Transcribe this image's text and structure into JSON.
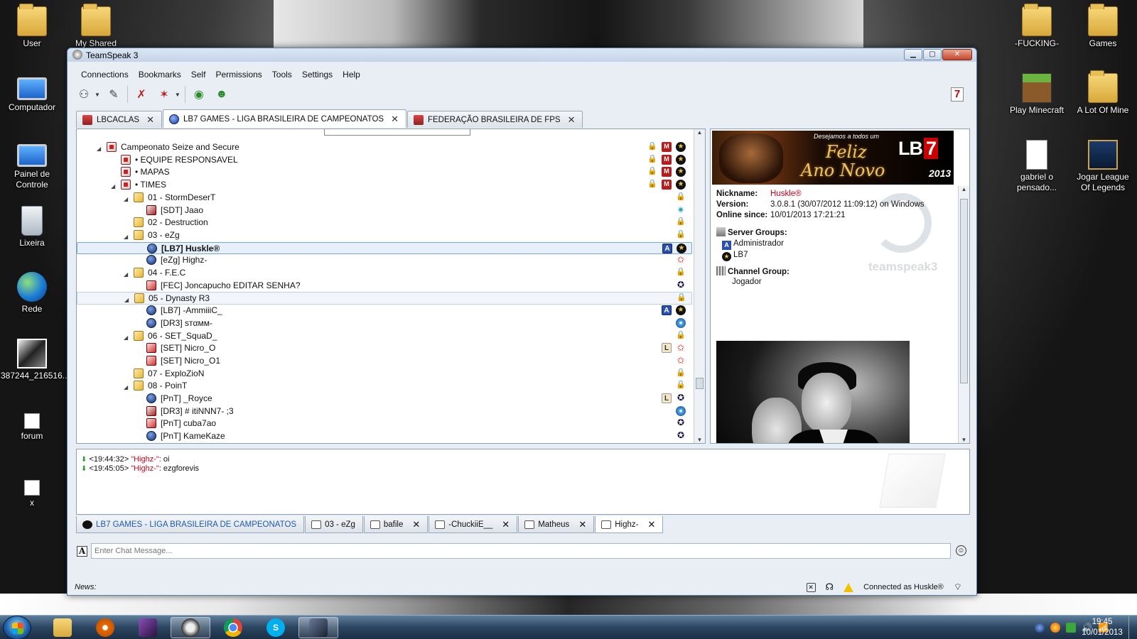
{
  "desktop": {
    "icons_left": [
      {
        "label": "User",
        "type": "folder"
      },
      {
        "label": "My Shared",
        "type": "folder"
      },
      {
        "label": "Computador",
        "type": "monitor"
      },
      {
        "label": "Painel de Controle",
        "type": "monitor"
      },
      {
        "label": "Lixeira",
        "type": "recycle"
      },
      {
        "label": "Rede",
        "type": "globe"
      },
      {
        "label": "387244_216516...",
        "type": "photo"
      },
      {
        "label": "forum",
        "type": "file"
      },
      {
        "label": "x",
        "type": "file"
      }
    ],
    "icons_right": [
      {
        "label": "-FUCKING-",
        "type": "folder"
      },
      {
        "label": "Games",
        "type": "folder"
      },
      {
        "label": "Play Minecraft",
        "type": "minecraft"
      },
      {
        "label": "A Lot Of Mine",
        "type": "folder"
      },
      {
        "label": "gabriel o pensado...",
        "type": "mp3"
      },
      {
        "label": "Jogar League Of Legends",
        "type": "lol"
      }
    ]
  },
  "window": {
    "title": "TeamSpeak 3",
    "controls": [
      "minimize",
      "maximize",
      "close"
    ]
  },
  "menu": [
    "Connections",
    "Bookmarks",
    "Self",
    "Permissions",
    "Tools",
    "Settings",
    "Help"
  ],
  "server_tabs": [
    {
      "label": "LBCACLAS",
      "icon": "speaker",
      "active": false
    },
    {
      "label": "LB7 GAMES - LIGA BRASILEIRA DE CAMPEONATOS",
      "icon": "dot",
      "active": true
    },
    {
      "label": "FEDERAÇÃO BRASILEIRA DE FPS",
      "icon": "speaker",
      "active": false
    }
  ],
  "tree": [
    {
      "label": "Campeonato Seize and Secure",
      "depth": 0,
      "kind": "channel",
      "arrow": true,
      "badges": [
        "lock",
        "m",
        "star"
      ]
    },
    {
      "label": "• EQUIPE RESPONSAVEL",
      "depth": 1,
      "kind": "channel",
      "arrow": false,
      "badges": [
        "lock",
        "m",
        "star"
      ]
    },
    {
      "label": "• MAPAS",
      "depth": 1,
      "kind": "channel",
      "arrow": false,
      "badges": [
        "lock",
        "m",
        "star"
      ]
    },
    {
      "label": "• TIMES",
      "depth": 1,
      "kind": "channel",
      "arrow": true,
      "badges": [
        "lock",
        "m",
        "star"
      ]
    },
    {
      "label": "01 - StormDeserT",
      "depth": 2,
      "kind": "channel2",
      "arrow": true,
      "badges": [
        "lock"
      ]
    },
    {
      "label": "[SDT] Jaao",
      "depth": 3,
      "kind": "speaker",
      "arrow": false,
      "badges": [
        "star2"
      ]
    },
    {
      "label": "02 - Destruction",
      "depth": 2,
      "kind": "channel2",
      "arrow": false,
      "badges": [
        "lock"
      ]
    },
    {
      "label": "03 - eZg",
      "depth": 2,
      "kind": "channel2",
      "arrow": true,
      "badges": [
        "lock"
      ]
    },
    {
      "label": "[LB7] Huskle®",
      "depth": 3,
      "kind": "user",
      "arrow": false,
      "badges": [
        "a",
        "star"
      ],
      "selected": true,
      "bold": true
    },
    {
      "label": "[eZg] Highz-",
      "depth": 3,
      "kind": "user",
      "arrow": false,
      "badges": [
        "star3"
      ]
    },
    {
      "label": "04 - F.E.C",
      "depth": 2,
      "kind": "channel2",
      "arrow": true,
      "badges": [
        "lock"
      ]
    },
    {
      "label": "[FEC] Joncapucho EDITAR SENHA?",
      "depth": 3,
      "kind": "muted",
      "arrow": false,
      "badges": [
        "ship"
      ]
    },
    {
      "label": "05 - Dynasty R3",
      "depth": 2,
      "kind": "channel2",
      "arrow": true,
      "badges": [
        "lock"
      ],
      "hover": true
    },
    {
      "label": "[LB7] -AmmiiiC_",
      "depth": 3,
      "kind": "user",
      "arrow": false,
      "badges": [
        "a",
        "star"
      ]
    },
    {
      "label": "[DR3] sтαмм-",
      "depth": 3,
      "kind": "user",
      "arrow": false,
      "badges": [
        "blue"
      ]
    },
    {
      "label": "06 - SET_SquaD_",
      "depth": 2,
      "kind": "channel2",
      "arrow": true,
      "badges": [
        "lock"
      ]
    },
    {
      "label": "[SET] Nicro_O",
      "depth": 3,
      "kind": "muted",
      "arrow": false,
      "badges": [
        "l",
        "star3"
      ]
    },
    {
      "label": "[SET] Nicro_O1",
      "depth": 3,
      "kind": "muted",
      "arrow": false,
      "badges": [
        "star3"
      ]
    },
    {
      "label": "07 - ExploZioN",
      "depth": 2,
      "kind": "channel2",
      "arrow": false,
      "badges": [
        "lock"
      ]
    },
    {
      "label": "08 - PoinT",
      "depth": 2,
      "kind": "channel2",
      "arrow": true,
      "badges": [
        "lock"
      ]
    },
    {
      "label": "[PnT] _Royce",
      "depth": 3,
      "kind": "user",
      "arrow": false,
      "badges": [
        "l",
        "ship"
      ]
    },
    {
      "label": "[DR3] # itiNNN7- ;3",
      "depth": 3,
      "kind": "speaker",
      "arrow": false,
      "badges": [
        "blue"
      ]
    },
    {
      "label": "[PnT] cuba7ao",
      "depth": 3,
      "kind": "muted",
      "arrow": false,
      "badges": [
        "ship"
      ]
    },
    {
      "label": "[PnT] KameKaze",
      "depth": 3,
      "kind": "user",
      "arrow": false,
      "badges": [
        "ship"
      ]
    }
  ],
  "info": {
    "banner": {
      "greeting": "Desejamos a todos um",
      "line1": "Feliz",
      "line2": "Ano Novo",
      "brand": "LB",
      "brand_num": "7",
      "year": "2013"
    },
    "nickname_label": "Nickname:",
    "nickname": "Huskle®",
    "version_label": "Version:",
    "version": "3.0.8.1 (30/07/2012 11:09:12) on Windows",
    "online_label": "Online since:",
    "online": "10/01/2013 17:21:21",
    "server_groups_label": "Server Groups:",
    "server_groups": [
      "Administrador",
      "LB7"
    ],
    "channel_group_label": "Channel Group:",
    "channel_group": "Jogador",
    "watermark": "teamspeak3"
  },
  "chat": {
    "lines": [
      {
        "time": "<19:44:32>",
        "name": "\"Highz-\"",
        "text": ": oi"
      },
      {
        "time": "<19:45:05>",
        "name": "\"Highz-\"",
        "text": ": ezgforevis"
      }
    ],
    "tabs": [
      {
        "label": "LB7 GAMES - LIGA BRASILEIRA DE CAMPEONATOS",
        "kind": "server",
        "closable": false
      },
      {
        "label": "03 - eZg",
        "kind": "channel",
        "closable": false
      },
      {
        "label": "bafile",
        "kind": "private",
        "closable": true
      },
      {
        "label": "-ChuckiiE__",
        "kind": "private",
        "closable": true
      },
      {
        "label": "Matheus",
        "kind": "private",
        "closable": true
      },
      {
        "label": "Highz-",
        "kind": "private",
        "closable": true,
        "active": true
      }
    ],
    "input_placeholder": "Enter Chat Message..."
  },
  "status": {
    "news_label": "News:",
    "connected": "Connected as Huskle®"
  },
  "taskbar": {
    "time": "19:45",
    "date": "10/01/2013"
  }
}
